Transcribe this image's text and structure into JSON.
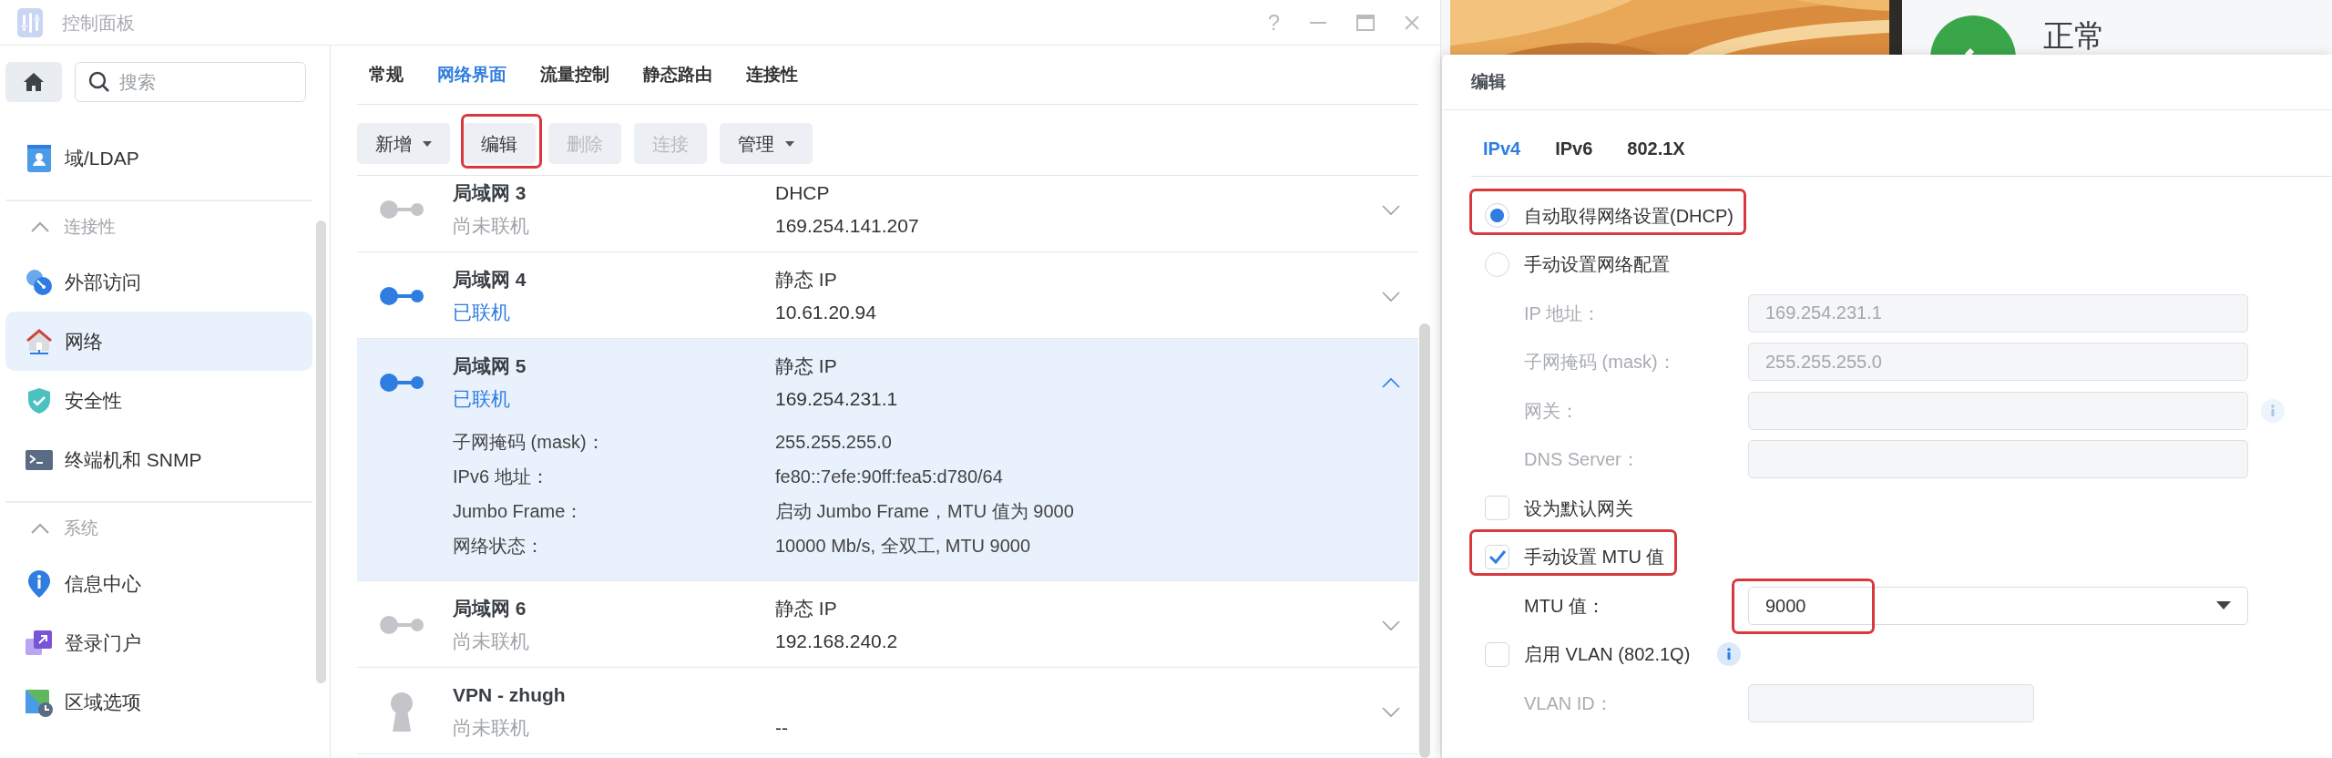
{
  "window": {
    "title": "控制面板",
    "help": "?"
  },
  "sidebar": {
    "search": {
      "placeholder": "搜索"
    },
    "items": [
      {
        "kind": "item",
        "label": "域/LDAP",
        "selected": false
      },
      {
        "kind": "section",
        "label": "连接性",
        "expanded": true
      },
      {
        "kind": "item",
        "label": "外部访问",
        "selected": false
      },
      {
        "kind": "item",
        "label": "网络",
        "selected": true
      },
      {
        "kind": "item",
        "label": "安全性",
        "selected": false
      },
      {
        "kind": "item",
        "label": "终端机和 SNMP",
        "selected": false
      },
      {
        "kind": "section",
        "label": "系统",
        "expanded": true
      },
      {
        "kind": "item",
        "label": "信息中心",
        "selected": false
      },
      {
        "kind": "item",
        "label": "登录门户",
        "selected": false
      },
      {
        "kind": "item",
        "label": "区域选项",
        "selected": false
      }
    ]
  },
  "tabs": [
    {
      "label": "常规",
      "selected": false
    },
    {
      "label": "网络界面",
      "selected": true
    },
    {
      "label": "流量控制",
      "selected": false
    },
    {
      "label": "静态路由",
      "selected": false
    },
    {
      "label": "连接性",
      "selected": false
    }
  ],
  "toolbar": [
    {
      "label": "新增",
      "dropdown": true,
      "disabled": false,
      "highlighted": false
    },
    {
      "label": "编辑",
      "dropdown": false,
      "disabled": false,
      "highlighted": true
    },
    {
      "label": "删除",
      "dropdown": false,
      "disabled": true,
      "highlighted": false
    },
    {
      "label": "连接",
      "dropdown": false,
      "disabled": true,
      "highlighted": false
    },
    {
      "label": "管理",
      "dropdown": true,
      "disabled": false,
      "highlighted": false
    }
  ],
  "interfaces": [
    {
      "kind": "lan",
      "name": "局域网 3",
      "status": "尚未联机",
      "connected": false,
      "type": "DHCP",
      "address": "169.254.141.207",
      "selected": false,
      "expanded": false
    },
    {
      "kind": "lan",
      "name": "局域网 4",
      "status": "已联机",
      "connected": true,
      "type": "静态 IP",
      "address": "10.61.20.94",
      "selected": false,
      "expanded": false
    },
    {
      "kind": "lan",
      "name": "局域网 5",
      "status": "已联机",
      "connected": true,
      "type": "静态 IP",
      "address": "169.254.231.1",
      "selected": true,
      "expanded": true,
      "details": [
        {
          "label": "子网掩码 (mask)：",
          "value": "255.255.255.0"
        },
        {
          "label": "IPv6 地址：",
          "value": "fe80::7efe:90ff:fea5:d780/64"
        },
        {
          "label": "Jumbo Frame：",
          "value": "启动 Jumbo Frame，MTU 值为 9000"
        },
        {
          "label": "网络状态：",
          "value": "10000 Mb/s, 全双工, MTU 9000"
        }
      ]
    },
    {
      "kind": "lan",
      "name": "局域网 6",
      "status": "尚未联机",
      "connected": false,
      "type": "静态 IP",
      "address": "192.168.240.2",
      "selected": false,
      "expanded": false
    },
    {
      "kind": "vpn",
      "name": "VPN - zhugh",
      "status": "尚未联机",
      "connected": false,
      "address": "--",
      "selected": false,
      "expanded": false
    }
  ],
  "background": {
    "status": "正常"
  },
  "dialog": {
    "title": "编辑",
    "tabs": [
      {
        "label": "IPv4",
        "selected": true
      },
      {
        "label": "IPv6",
        "selected": false
      },
      {
        "label": "802.1X",
        "selected": false
      }
    ],
    "rows": [
      {
        "kind": "radio",
        "label": "自动取得网络设置(DHCP)",
        "selected": true,
        "highlighted": true
      },
      {
        "kind": "radio",
        "label": "手动设置网络配置",
        "selected": false,
        "highlighted": false
      },
      {
        "kind": "field",
        "label": "IP 地址：",
        "value": "169.254.231.1",
        "disabled": true,
        "info": false
      },
      {
        "kind": "field",
        "label": "子网掩码 (mask)：",
        "value": "255.255.255.0",
        "disabled": true,
        "info": false
      },
      {
        "kind": "field",
        "label": "网关：",
        "disabled": true,
        "info": true
      },
      {
        "kind": "field",
        "label": "DNS Server：",
        "disabled": true,
        "info": false
      },
      {
        "kind": "checkbox",
        "label": "设为默认网关",
        "checked": false,
        "highlighted": false,
        "info": false
      },
      {
        "kind": "checkbox",
        "label": "手动设置 MTU 值",
        "checked": true,
        "highlighted": true,
        "info": false
      },
      {
        "kind": "select",
        "label": "MTU 值：",
        "value": "9000",
        "highlighted": true
      },
      {
        "kind": "checkbox",
        "label": "启用 VLAN (802.1Q)",
        "checked": false,
        "highlighted": false,
        "info": true
      },
      {
        "kind": "short_field",
        "label": "VLAN ID：",
        "disabled": true,
        "info": false
      }
    ]
  }
}
